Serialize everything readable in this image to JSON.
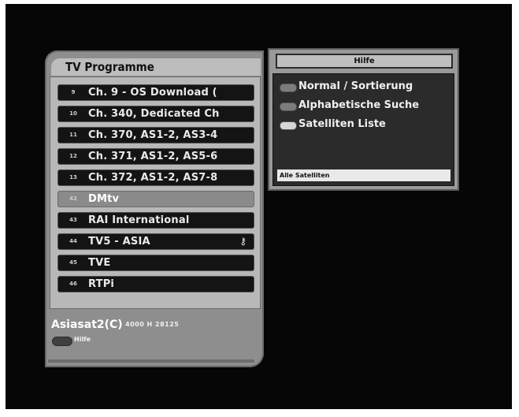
{
  "programme_panel": {
    "title": "TV Programme",
    "channels": [
      {
        "num": "9",
        "name": "Ch. 9 - OS Download (",
        "selected": false,
        "lock": ""
      },
      {
        "num": "10",
        "name": "Ch. 340, Dedicated Ch",
        "selected": false,
        "lock": ""
      },
      {
        "num": "11",
        "name": "Ch. 370, AS1-2, AS3-4",
        "selected": false,
        "lock": ""
      },
      {
        "num": "12",
        "name": "Ch. 371, AS1-2, AS5-6",
        "selected": false,
        "lock": ""
      },
      {
        "num": "13",
        "name": "Ch. 372, AS1-2, AS7-8",
        "selected": false,
        "lock": ""
      },
      {
        "num": "42",
        "name": "DMtv",
        "selected": true,
        "lock": ""
      },
      {
        "num": "43",
        "name": "RAI International",
        "selected": false,
        "lock": ""
      },
      {
        "num": "44",
        "name": "TV5 - ASIA",
        "selected": false,
        "lock": "⚷"
      },
      {
        "num": "45",
        "name": "TVE",
        "selected": false,
        "lock": ""
      },
      {
        "num": "46",
        "name": "RTPi",
        "selected": false,
        "lock": ""
      }
    ],
    "satellite": "Asiasat2(C)",
    "transponder": "4000 H 28125",
    "help_label": "Hilfe"
  },
  "help_panel": {
    "title": "Hilfe",
    "options": [
      {
        "label": "Normal / Sortierung",
        "key": "grey"
      },
      {
        "label": "Alphabetische Suche",
        "key": "grey"
      },
      {
        "label": "Satelliten Liste",
        "key": "light"
      }
    ],
    "status": "Alle Satelliten"
  },
  "colors": {
    "screen_bg": "#060606",
    "panel_bg": "#8e8e8e",
    "row_bg": "#141414",
    "row_selected_bg": "#8a8a8a"
  }
}
